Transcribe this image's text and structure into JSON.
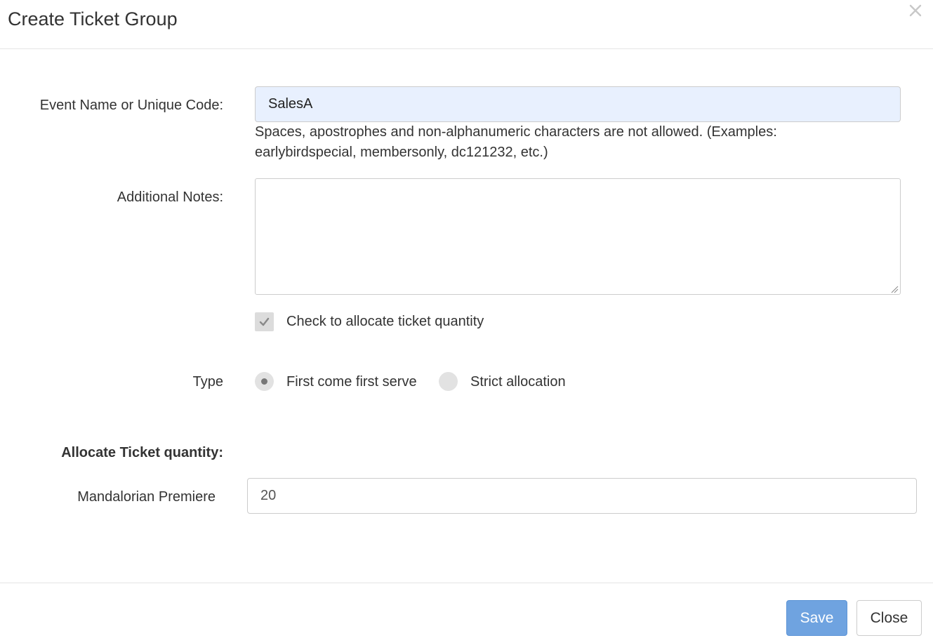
{
  "header": {
    "title": "Create Ticket Group",
    "close_icon": "close-icon"
  },
  "form": {
    "event_name": {
      "label": "Event Name or Unique Code:",
      "value": "SalesA",
      "help_line1": "Spaces, apostrophes and non-alphanumeric characters are not allowed. (Examples:",
      "help_line2": "earlybirdspecial, membersonly, dc121232, etc.)"
    },
    "notes": {
      "label": "Additional Notes:",
      "value": ""
    },
    "allocate_checkbox": {
      "label": "Check to allocate ticket quantity",
      "checked": true
    },
    "type": {
      "label": "Type",
      "options": [
        {
          "label": "First come first serve",
          "selected": true
        },
        {
          "label": "Strict allocation",
          "selected": false
        }
      ]
    },
    "allocation": {
      "heading": "Allocate Ticket quantity:",
      "items": [
        {
          "label": "Mandalorian Premiere",
          "value": "20"
        }
      ]
    }
  },
  "footer": {
    "save_label": "Save",
    "close_label": "Close"
  },
  "colors": {
    "primary": "#6fa3e0",
    "autofill_bg": "#e8f0fe",
    "border": "#cccccc"
  }
}
